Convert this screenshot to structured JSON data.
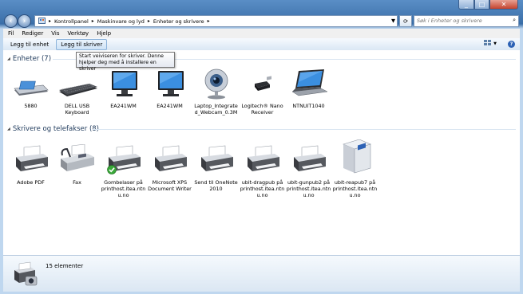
{
  "address": {
    "parts": [
      "Kontrollpanel",
      "Maskinvare og lyd",
      "Enheter og skrivere"
    ]
  },
  "search": {
    "placeholder": "Søk i Enheter og skrivere"
  },
  "menu": [
    "Fil",
    "Rediger",
    "Vis",
    "Verktøy",
    "Hjelp"
  ],
  "toolbar": {
    "add_device": "Legg til enhet",
    "add_printer": "Legg til skriver"
  },
  "tooltip": {
    "text": "Start veiviseren for skriver. Denne hjelper deg med å installere en skriver"
  },
  "groups": {
    "devices": {
      "title": "Enheter (7)"
    },
    "printers": {
      "title": "Skrivere og telefakser (8)"
    }
  },
  "devices": [
    {
      "label": "5880",
      "icon": "card-reader-icon"
    },
    {
      "label": "DELL USB Keyboard",
      "icon": "keyboard-icon"
    },
    {
      "label": "EA241WM",
      "icon": "monitor-icon"
    },
    {
      "label": "EA241WM",
      "icon": "monitor-icon"
    },
    {
      "label": "Laptop_Integrate d_Webcam_0.3M",
      "icon": "webcam-icon"
    },
    {
      "label": "Logitech® Nano Receiver",
      "icon": "usb-receiver-icon"
    },
    {
      "label": "NTNUIT1040",
      "icon": "laptop-icon"
    }
  ],
  "printers": [
    {
      "label": "Adobe PDF",
      "icon": "printer-icon"
    },
    {
      "label": "Fax",
      "icon": "fax-icon"
    },
    {
      "label": "Gombelaser på printhost.itea.ntn u.no",
      "icon": "printer-icon",
      "default": true
    },
    {
      "label": "Microsoft XPS Document Writer",
      "icon": "printer-icon"
    },
    {
      "label": "Send til OneNote 2010",
      "icon": "printer-icon"
    },
    {
      "label": "ubit-dragpub på printhost.itea.ntn u.no",
      "icon": "printer-icon"
    },
    {
      "label": "ubit-gunpub2 på printhost.itea.ntn u.no",
      "icon": "printer-icon"
    },
    {
      "label": "ubit-reapub7 på printhost.itea.ntn u.no",
      "icon": "network-printer-icon"
    }
  ],
  "details": {
    "count": "15 elementer"
  }
}
